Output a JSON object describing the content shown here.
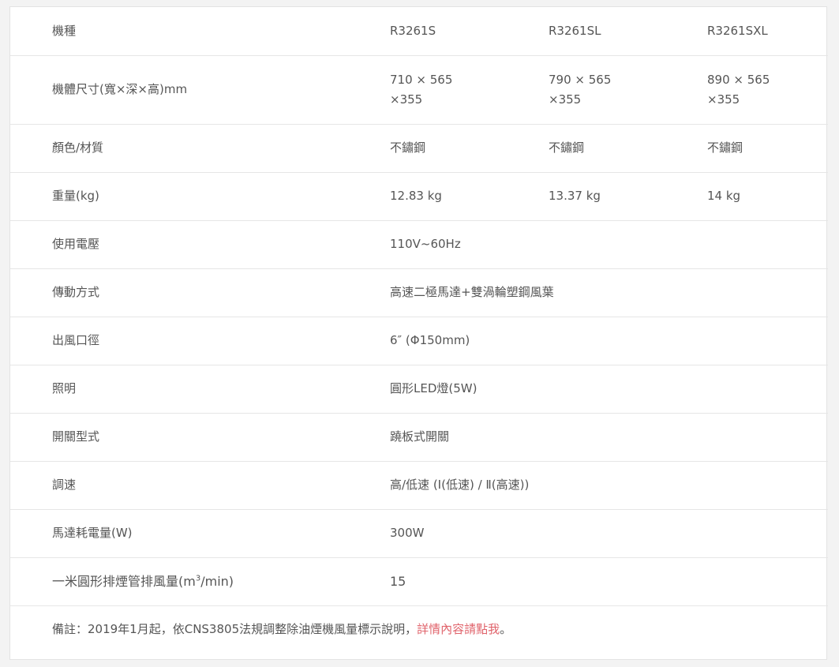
{
  "header": {
    "label": "機種",
    "models": [
      "R3261S",
      "R3261SL",
      "R3261SXL"
    ]
  },
  "rows": {
    "size": {
      "label": "機體尺寸(寬×深×高)mm",
      "values": [
        {
          "line1": "710 × 565",
          "line2": "×355"
        },
        {
          "line1": "790 × 565",
          "line2": "×355"
        },
        {
          "line1": "890 × 565",
          "line2": "×355"
        }
      ]
    },
    "color": {
      "label": "顏色/材質",
      "values": [
        "不鏽鋼",
        "不鏽鋼",
        "不鏽鋼"
      ]
    },
    "weight": {
      "label": "重量(kg)",
      "values": [
        "12.83 kg",
        "13.37 kg",
        "14 kg"
      ]
    },
    "voltage": {
      "label": "使用電壓",
      "value": "110V~60Hz"
    },
    "drive": {
      "label": "傳動方式",
      "value": "高速二極馬達+雙渦輪塑鋼風葉"
    },
    "outlet": {
      "label": "出風口徑",
      "value": "6″ (Φ150mm)"
    },
    "lighting": {
      "label": "照明",
      "value": "圓形LED燈(5W)"
    },
    "switch": {
      "label": "開關型式",
      "value": "蹺板式開關"
    },
    "speed": {
      "label": "調速",
      "value": "高/低速 (Ⅰ(低速) / Ⅱ(高速))"
    },
    "power": {
      "label": "馬達耗電量(W)",
      "value": "300W"
    },
    "airflow": {
      "label_prefix": "一米圓形排煙管排風量(m",
      "label_sup": "3",
      "label_suffix": "/min)",
      "value": "15"
    }
  },
  "note": {
    "text": "備註：2019年1月起，依CNS3805法規調整除油煙機風量標示說明，",
    "link": "詳情內容請點我",
    "end": "。"
  },
  "colors": {
    "link": "#e0636b",
    "text": "#555555",
    "border": "#e6e6e6"
  }
}
